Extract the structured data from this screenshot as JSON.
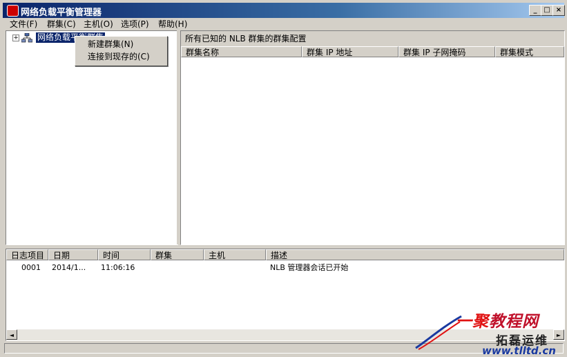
{
  "window": {
    "title": "网络负载平衡管理器",
    "controls": {
      "minimize": "_",
      "maximize": "□",
      "close": "×"
    }
  },
  "menubar": {
    "items": [
      {
        "label": "文件(F)"
      },
      {
        "label": "群集(C)"
      },
      {
        "label": "主机(O)"
      },
      {
        "label": "选项(P)"
      },
      {
        "label": "帮助(H)"
      }
    ]
  },
  "tree": {
    "expander": "+",
    "root_icon": "cluster-network-icon",
    "root_label": "网络负载平衡群集"
  },
  "context_menu": {
    "items": [
      {
        "label": "新建群集(N)"
      },
      {
        "label": "连接到现存的(C)"
      }
    ]
  },
  "right_pane": {
    "caption": "所有已知的 NLB 群集的群集配置",
    "columns": [
      "群集名称",
      "群集 IP 地址",
      "群集 IP 子网掩码",
      "群集模式"
    ]
  },
  "log": {
    "columns": [
      "日志项目",
      "日期",
      "时间",
      "群集",
      "主机",
      "描述"
    ],
    "rows": [
      {
        "id": "0001",
        "date": "2014/1...",
        "time": "11:06:16",
        "cluster": "",
        "host": "",
        "desc": "NLB 管理器会话已开始"
      }
    ]
  },
  "scrollbar": {
    "left_arrow": "◄",
    "right_arrow": "►"
  },
  "watermark": {
    "brand_a": "一聚",
    "brand_b": "教程网",
    "sub": "拓磊运维",
    "url": "www.tlltd.cn"
  },
  "colors": {
    "titlebar_start": "#0a246a",
    "titlebar_end": "#a6caf0",
    "selection": "#0a246a",
    "face": "#d4d0c8",
    "watermark_red": "#e01111",
    "watermark_blue": "#1a3aa0"
  }
}
